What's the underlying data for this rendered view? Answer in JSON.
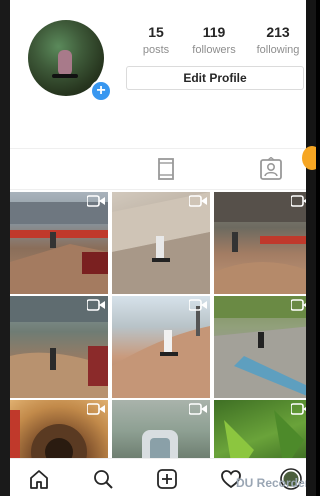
{
  "profile": {
    "posts_count": "15",
    "posts_label": "posts",
    "followers_count": "119",
    "followers_label": "followers",
    "following_count": "213",
    "following_label": "following",
    "edit_profile_label": "Edit Profile",
    "add_story_badge": "+"
  },
  "tabs": [
    {
      "icon": "grid-icon",
      "active": true
    },
    {
      "icon": "feed-list-icon",
      "active": false
    },
    {
      "icon": "tagged-icon",
      "active": false
    }
  ],
  "posts": [
    {
      "type": "video"
    },
    {
      "type": "video"
    },
    {
      "type": "video"
    },
    {
      "type": "video"
    },
    {
      "type": "video"
    },
    {
      "type": "video"
    },
    {
      "type": "video"
    },
    {
      "type": "video"
    },
    {
      "type": "video"
    }
  ],
  "bottom_nav": [
    {
      "icon": "home-icon"
    },
    {
      "icon": "search-icon"
    },
    {
      "icon": "add-post-icon"
    },
    {
      "icon": "heart-icon"
    },
    {
      "icon": "profile-icon"
    }
  ],
  "watermark": "DU Recorder",
  "colors": {
    "accent": "#3897f0",
    "active_tab": "#3897f0",
    "text": "#262626",
    "muted": "#8e8e8e"
  }
}
